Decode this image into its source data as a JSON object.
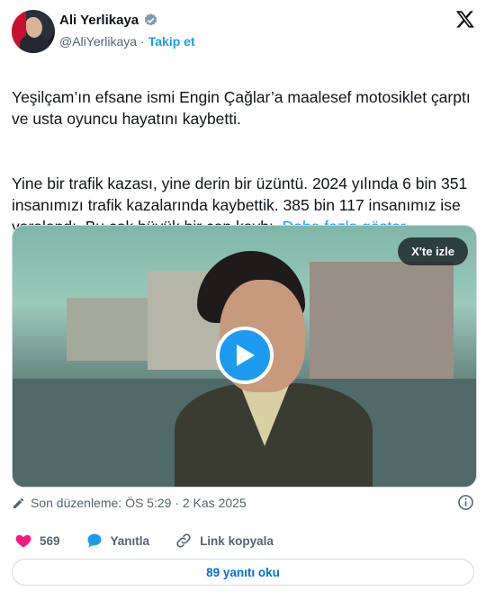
{
  "author": {
    "name": "Ali Yerlikaya",
    "handle": "@AliYerlikaya",
    "separator": "·",
    "follow_label": "Takip et"
  },
  "tweet": {
    "paragraph1": "Yeşilçam’ın efsane ismi Engin Çağlar’a maalesef motosiklet çarptı ve usta oyuncu hayatını kaybetti.",
    "paragraph2": "Yine bir trafik kazası, yine derin bir üzüntü. 2024 yılında 6 bin 351 insanımızı trafik kazalarında kaybettik. 385 bin 117 insanımız ise yaralandı. Bu çok büyük bir can kaybı.",
    "show_more": "Daha fazla göster"
  },
  "media": {
    "watch_label": "X'te izle"
  },
  "meta": {
    "edited_label": "Son düzenleme: ÖS 5:29 · 2 Kas 2025"
  },
  "actions": {
    "like_count": "569",
    "reply_label": "Yanıtla",
    "copy_link_label": "Link kopyala"
  },
  "replies": {
    "label": "89 yanıtı oku"
  },
  "colors": {
    "accent": "#1d9bf0",
    "like": "#f91880",
    "text": "#0f1419",
    "secondary": "#536471"
  },
  "icons": [
    "verified-badge-icon",
    "x-logo-icon",
    "play-icon",
    "pencil-icon",
    "info-icon",
    "heart-icon",
    "reply-bubble-icon",
    "link-icon"
  ]
}
